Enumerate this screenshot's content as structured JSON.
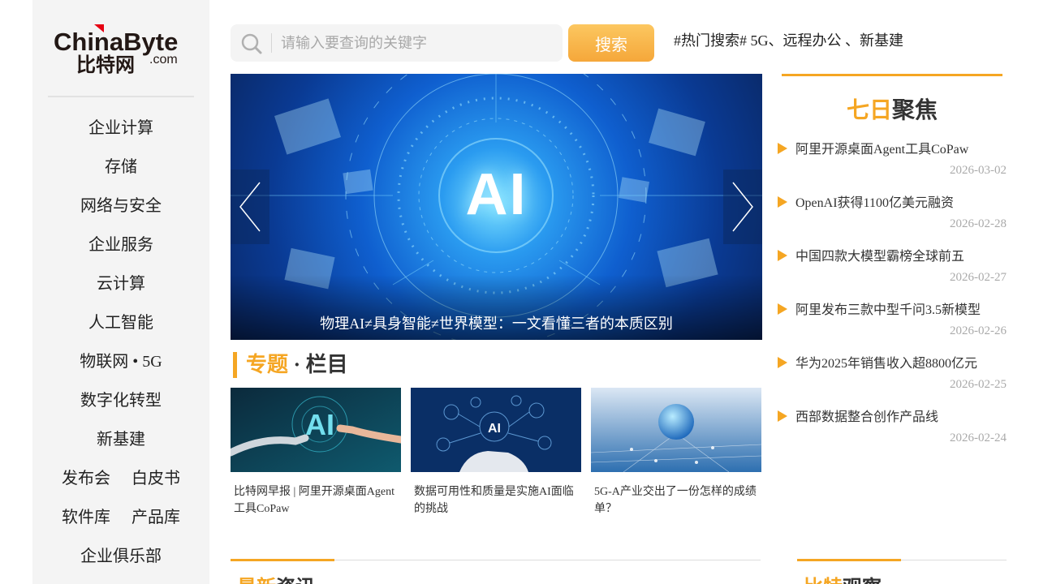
{
  "brand": {
    "logo_line1": "ChinaByte",
    "logo_line2": "比特网",
    "logo_suffix": ".com"
  },
  "sidebar": {
    "items": [
      {
        "label": "企业计算"
      },
      {
        "label": "存储"
      },
      {
        "label": "网络与安全"
      },
      {
        "label": "企业服务"
      },
      {
        "label": "云计算"
      },
      {
        "label": "人工智能"
      },
      {
        "label": "物联网 • 5G"
      },
      {
        "label": "数字化转型"
      },
      {
        "label": "新基建"
      }
    ],
    "pair_rows": [
      {
        "left": "发布会",
        "right": "白皮书"
      },
      {
        "left": "软件库",
        "right": "产品库"
      }
    ],
    "club": "企业俱乐部"
  },
  "search": {
    "placeholder": "请输入要查询的关键字",
    "value": "",
    "button_label": "搜索",
    "icon": "search-icon"
  },
  "hot_search": {
    "text": "#热门搜索# 5G、远程办公 、新基建"
  },
  "banner": {
    "image_text": "AI",
    "caption": "物理AI≠具身智能≠世界模型：一文看懂三者的本质区别",
    "prev_icon": "chevron-left-icon",
    "next_icon": "chevron-right-icon"
  },
  "topics": {
    "title_highlight": "专题",
    "title_rest": " · 栏目",
    "cards": [
      {
        "title": "比特网早报 | 阿里开源桌面Agent工具CoPaw",
        "image_text": "AI"
      },
      {
        "title": "数据可用性和质量是实施AI面临的挑战",
        "image_text": "AI"
      },
      {
        "title": "5G-A产业交出了一份怎样的成绩单？"
      }
    ]
  },
  "focus": {
    "title_highlight": "七日",
    "title_rest": "聚焦",
    "items": [
      {
        "title": "阿里开源桌面Agent工具CoPaw",
        "date": "2026-03-02"
      },
      {
        "title": "OpenAI获得1100亿美元融资",
        "date": "2026-02-28"
      },
      {
        "title": "中国四款大模型霸榜全球前五",
        "date": "2026-02-27"
      },
      {
        "title": "阿里发布三款中型千问3.5新模型",
        "date": "2026-02-26"
      },
      {
        "title": "华为2025年销售收入超8800亿元",
        "date": "2026-02-25"
      },
      {
        "title": "西部数据整合创作产品线",
        "date": "2026-02-24"
      }
    ]
  },
  "latest": {
    "title_highlight": "最新",
    "title_rest": "资讯"
  },
  "view": {
    "title_highlight": "比特",
    "title_rest": "观察"
  },
  "colors": {
    "accent": "#f5a623",
    "brand_red": "#e60012",
    "sidebar_bg": "#f4f4f4"
  }
}
